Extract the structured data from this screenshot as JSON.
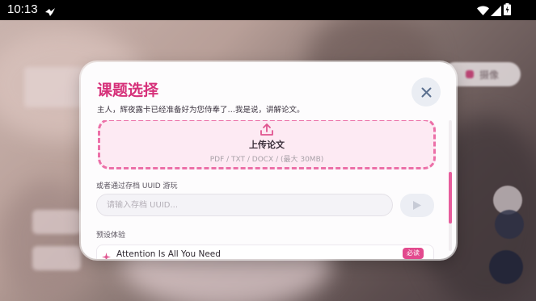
{
  "status_bar": {
    "time": "10:13"
  },
  "background": {
    "pill_label": "摄像"
  },
  "modal": {
    "title": "课题选择",
    "subtitle": "主人，辉夜露卡已经准备好为您侍奉了…我是说，讲解论文。",
    "upload": {
      "label": "上传论文",
      "hint": "PDF / TXT / DOCX / (最大 30MB)"
    },
    "uuid": {
      "label": "或者通过存档 UUID 游玩",
      "placeholder": "请输入存档 UUID..."
    },
    "presets": {
      "label": "预设体验",
      "items": [
        {
          "title": "Attention Is All You Need",
          "tag": "必读"
        }
      ]
    }
  },
  "colors": {
    "accent": "#d6317a",
    "upload_border": "#ec70a8",
    "upload_bg": "#fdeaf3",
    "scroll_thumb": "#e65d9c"
  },
  "icons": [
    "bird-icon",
    "wifi-icon",
    "signal-icon",
    "battery-icon",
    "close-icon",
    "upload-icon",
    "play-icon",
    "sparkle-icon"
  ]
}
